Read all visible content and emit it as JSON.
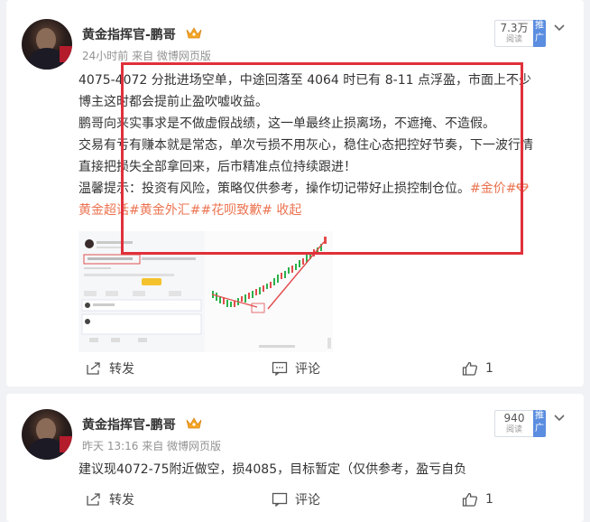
{
  "posts": [
    {
      "author": "黄金指挥官-鹏哥",
      "time": "24小时前",
      "source": "来自 微博网页版",
      "views": "7.3万",
      "views_label": "阅读",
      "promote_label": "推广",
      "lines": [
        "4075-4072 分批进场空单，中途回落至 4064 时已有 8-11 点浮盈，市面上不少",
        "博主这时都会提前止盈吹嘘收益。",
        "鹏哥向来实事求是不做虚假战绩，这一单最终止损离场，不遮掩、不造假。",
        "交易有亏有赚本就是常态，单次亏损不用灰心，稳住心态把控好节奏，下一波行情",
        "直接把损失全部拿回来，后市精准点位持续跟进！",
        "温馨提示：投资有风险，策略仅供参考，操作切记带好止损控制仓位。"
      ],
      "tag_inline": "#金价#",
      "tag_line": "黄金超话#黄金外汇##花呗致歉# 收起",
      "actions": {
        "repost": "转发",
        "comment": "评论",
        "like_count": "1"
      }
    },
    {
      "author": "黄金指挥官-鹏哥",
      "time": "昨天 13:16",
      "source": "来自 微博网页版",
      "views": "940",
      "views_label": "阅读",
      "promote_label": "推广",
      "text": "建议现4072-75附近做空，损4085，目标暂定（仅供参考，盈亏自负",
      "actions": {
        "repost": "转发",
        "comment": "评论",
        "like_count": "1"
      }
    }
  ],
  "colors": {
    "link": "#eb7350",
    "highlight_box": "#e0303a",
    "promote": "#5b8de0"
  },
  "icons": [
    "crown-icon",
    "chevron-down-icon",
    "repost-icon",
    "comment-icon",
    "like-icon"
  ]
}
